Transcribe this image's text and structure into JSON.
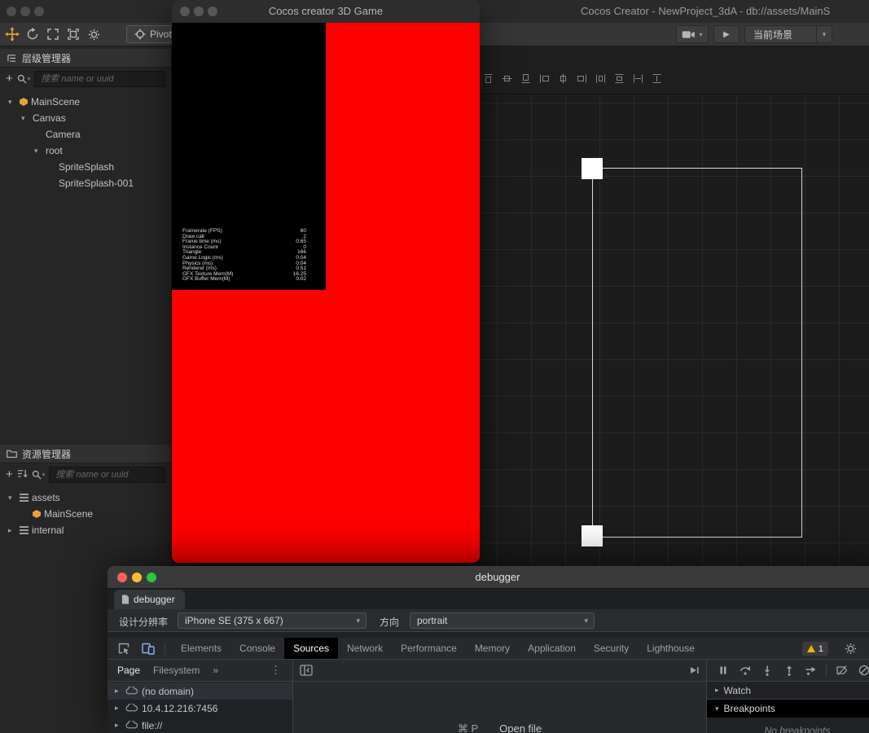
{
  "colors": {
    "accent_orange": "#e8a33d",
    "game_red": "#fe0000",
    "devtools_blue": "#8ab4f8",
    "warning_yellow": "#f0b400"
  },
  "editor": {
    "title": "Cocos Creator - NewProject_3dA - db://assets/MainS",
    "toolbar": {
      "left_icons": [
        "move-tool",
        "refresh",
        "fullscreen",
        "frame-selection",
        "settings"
      ],
      "pivot_label": "Pivot",
      "scene_select_label": "当前场景"
    },
    "scene_align_icons": [
      "align-top",
      "align-middle",
      "align-bottom",
      "align-left",
      "align-center",
      "align-right",
      "distribute-horizontal",
      "distribute-vertical",
      "stretch-horizontal",
      "stretch-vertical"
    ],
    "hierarchy": {
      "title": "层级管理器",
      "search_placeholder": "搜索 name or uuid",
      "nodes": [
        {
          "label": "MainScene",
          "depth": 0,
          "arrow": "expanded",
          "icon": "scene"
        },
        {
          "label": "Canvas",
          "depth": 1,
          "arrow": "expanded",
          "icon": null
        },
        {
          "label": "Camera",
          "depth": 2,
          "arrow": null,
          "icon": null
        },
        {
          "label": "root",
          "depth": 2,
          "arrow": "expanded",
          "icon": null
        },
        {
          "label": "SpriteSplash",
          "depth": 3,
          "arrow": null,
          "icon": null
        },
        {
          "label": "SpriteSplash-001",
          "depth": 3,
          "arrow": null,
          "icon": null
        }
      ]
    },
    "assets": {
      "title": "资源管理器",
      "search_placeholder": "搜索 name or uuid",
      "nodes": [
        {
          "label": "assets",
          "depth": 0,
          "arrow": "expanded",
          "icon": "stack"
        },
        {
          "label": "MainScene",
          "depth": 1,
          "arrow": null,
          "icon": "scene"
        },
        {
          "label": "internal",
          "depth": 0,
          "arrow": "collapsed",
          "icon": "stack"
        }
      ]
    }
  },
  "game": {
    "title": "Cocos creator 3D Game",
    "stats": [
      {
        "label": "Framerate (FPS)",
        "value": "60"
      },
      {
        "label": "Draw call",
        "value": "2"
      },
      {
        "label": "Frame time (ms)",
        "value": "0.65"
      },
      {
        "label": "Instance Count",
        "value": "0"
      },
      {
        "label": "Triangle",
        "value": "166"
      },
      {
        "label": "Game Logic (ms)",
        "value": "0.04"
      },
      {
        "label": "Physics (ms)",
        "value": "0.04"
      },
      {
        "label": "Renderer (ms)",
        "value": "0.51"
      },
      {
        "label": "GFX Texture Mem(M)",
        "value": "16.25"
      },
      {
        "label": "GFX Buffer Mem(M)",
        "value": "0.02"
      }
    ]
  },
  "devtools": {
    "window_title": "debugger",
    "tab_label": "debugger",
    "device_bar": {
      "resolution_label": "设计分辨率",
      "device_value": "iPhone SE (375 x 667)",
      "orientation_label": "方向",
      "orientation_value": "portrait"
    },
    "panel_tabs": [
      "Elements",
      "Console",
      "Sources",
      "Network",
      "Performance",
      "Memory",
      "Application",
      "Security",
      "Lighthouse"
    ],
    "active_panel_tab": "Sources",
    "warning_count": "1",
    "sources": {
      "nav_tabs": [
        "Page",
        "Filesystem"
      ],
      "active_nav_tab": "Page",
      "nav_overflow": "»",
      "tree": [
        "(no domain)",
        "10.4.12.216:7456",
        "file://"
      ],
      "open_file_shortcut": "⌘ P",
      "open_file_label": "Open file"
    },
    "debug_sidebar": {
      "watch_label": "Watch",
      "breakpoints_label": "Breakpoints",
      "empty_breakpoints": "No breakpoints"
    }
  }
}
